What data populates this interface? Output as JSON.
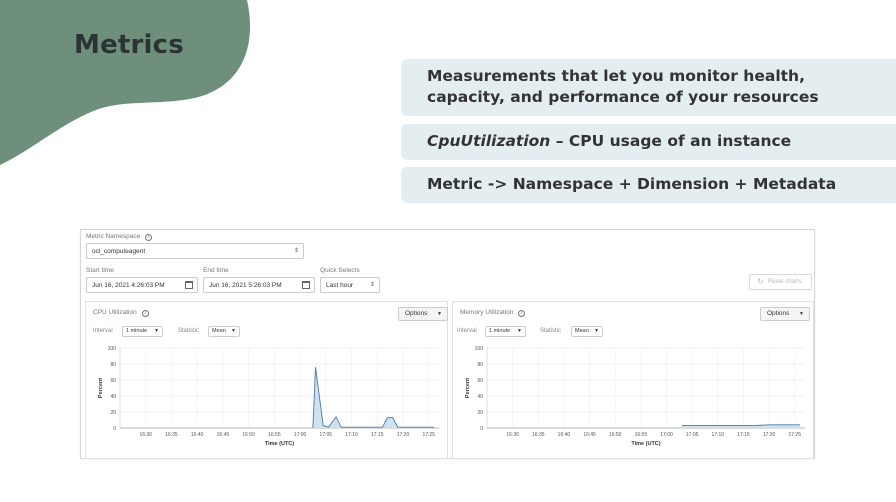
{
  "slide": {
    "title": "Metrics",
    "bullets": [
      "Measurements that let you monitor health, capacity, and performance of your resources",
      "– CPU usage of an instance",
      "Metric -> Namespace + Dimension + Metadata"
    ],
    "bullet2_italic": "CpuUtilization",
    "colors": {
      "blob": "#6e8f7c",
      "bullet_bg": "#e4eef1"
    }
  },
  "console": {
    "namespace_label": "Metric Namespace",
    "namespace_value": "oci_computeagent",
    "start_label": "Start time",
    "start_value": "Jun 16, 2021 4:26:03 PM",
    "end_label": "End time",
    "end_value": "Jun 16, 2021 5:26:03 PM",
    "quick_label": "Quick Selects",
    "quick_value": "Last hour",
    "reset_label": "Reset charts",
    "interval_label": "Interval",
    "statistic_label": "Statistic",
    "options_label": "Options"
  },
  "chart_data": [
    {
      "type": "area",
      "title": "CPU Utilization",
      "interval": "1 minute",
      "statistic": "Mean",
      "xlabel": "Time (UTC)",
      "ylabel": "Percent",
      "ylim": [
        0,
        100
      ],
      "yticks": [
        0,
        20,
        40,
        60,
        80,
        100
      ],
      "xticks": [
        "16:30",
        "16:35",
        "16:40",
        "16:45",
        "16:50",
        "16:55",
        "17:00",
        "17:05",
        "17:10",
        "17:15",
        "17:20",
        "17:25"
      ],
      "xrange_min": [
        0,
        62
      ],
      "points": [
        [
          37.5,
          0
        ],
        [
          38,
          76
        ],
        [
          39.5,
          3
        ],
        [
          40.5,
          1
        ],
        [
          42,
          14
        ],
        [
          43,
          1
        ],
        [
          47,
          1
        ],
        [
          51,
          1
        ],
        [
          52,
          13
        ],
        [
          53,
          13
        ],
        [
          54,
          1
        ],
        [
          60,
          1
        ],
        [
          61,
          1
        ]
      ]
    },
    {
      "type": "area",
      "title": "Memory Utilization",
      "interval": "1 minute",
      "statistic": "Mean",
      "xlabel": "Time (UTC)",
      "ylabel": "Percent",
      "ylim": [
        0,
        100
      ],
      "yticks": [
        0,
        20,
        40,
        60,
        80,
        100
      ],
      "xticks": [
        "16:30",
        "16:35",
        "16:40",
        "16:45",
        "16:50",
        "16:55",
        "17:00",
        "17:05",
        "17:10",
        "17:15",
        "17:20",
        "17:25"
      ],
      "xrange_min": [
        0,
        62
      ],
      "points": [
        [
          38,
          3
        ],
        [
          45,
          3
        ],
        [
          52,
          3
        ],
        [
          55,
          4
        ],
        [
          58,
          4
        ],
        [
          61,
          4
        ]
      ]
    }
  ]
}
